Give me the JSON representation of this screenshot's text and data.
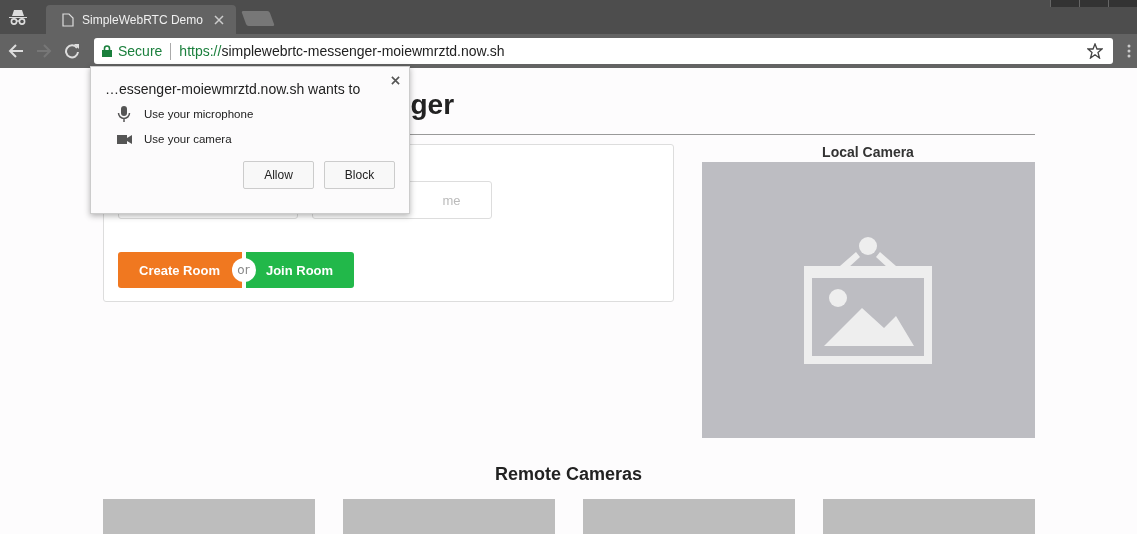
{
  "browser": {
    "tabs": [
      {
        "title": "SimpleWebRTC Demo",
        "selected": true
      }
    ],
    "address_bar": {
      "security": "Secure",
      "url_scheme": "https://",
      "url_rest": "simplewebrtc-messenger-moiewmrztd.now.sh"
    }
  },
  "permission_popup": {
    "title": "…essenger-moiewmrztd.now.sh wants to",
    "requests": [
      {
        "kind": "microphone",
        "label": "Use your microphone"
      },
      {
        "kind": "camera",
        "label": "Use your camera"
      }
    ],
    "buttons": [
      "Allow",
      "Block"
    ]
  },
  "page": {
    "heading": "ger",
    "room_form": {
      "name_placeholder": "me",
      "create_button": "Create Room",
      "separator": "or",
      "join_button": "Join Room"
    },
    "local_camera": {
      "label": "Local Camera"
    },
    "remote_cameras": {
      "heading": "Remote Cameras"
    }
  }
}
